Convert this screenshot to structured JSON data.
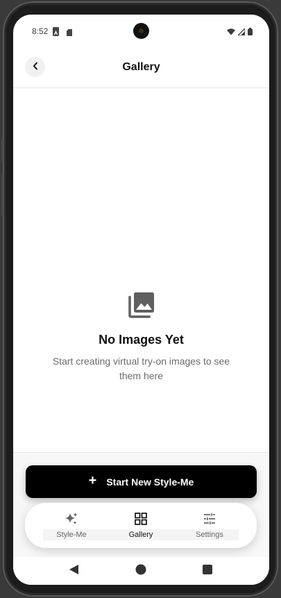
{
  "status_bar": {
    "time": "8:52",
    "left_icons": [
      "a-notification-icon",
      "sd-card-icon"
    ],
    "right_icons": [
      "wifi-icon",
      "signal-icon",
      "battery-icon"
    ]
  },
  "header": {
    "title": "Gallery",
    "back_icon": "chevron-left-icon"
  },
  "empty_state": {
    "icon": "photo-library-icon",
    "title": "No Images Yet",
    "description": "Start creating virtual try-on images to see them here"
  },
  "cta": {
    "icon": "plus-icon",
    "label": "Start New Style-Me"
  },
  "tabs": [
    {
      "label": "Style-Me",
      "icon": "sparkles-icon",
      "active": false
    },
    {
      "label": "Gallery",
      "icon": "grid-icon",
      "active": true
    },
    {
      "label": "Settings",
      "icon": "sliders-icon",
      "active": false
    }
  ],
  "navigation": [
    "back-triangle-icon",
    "home-circle-icon",
    "recents-square-icon"
  ],
  "colors": {
    "primary": "#000000",
    "background": "#ffffff",
    "muted_text": "#6b6b6b",
    "icon_gray": "#5f5f5f"
  }
}
